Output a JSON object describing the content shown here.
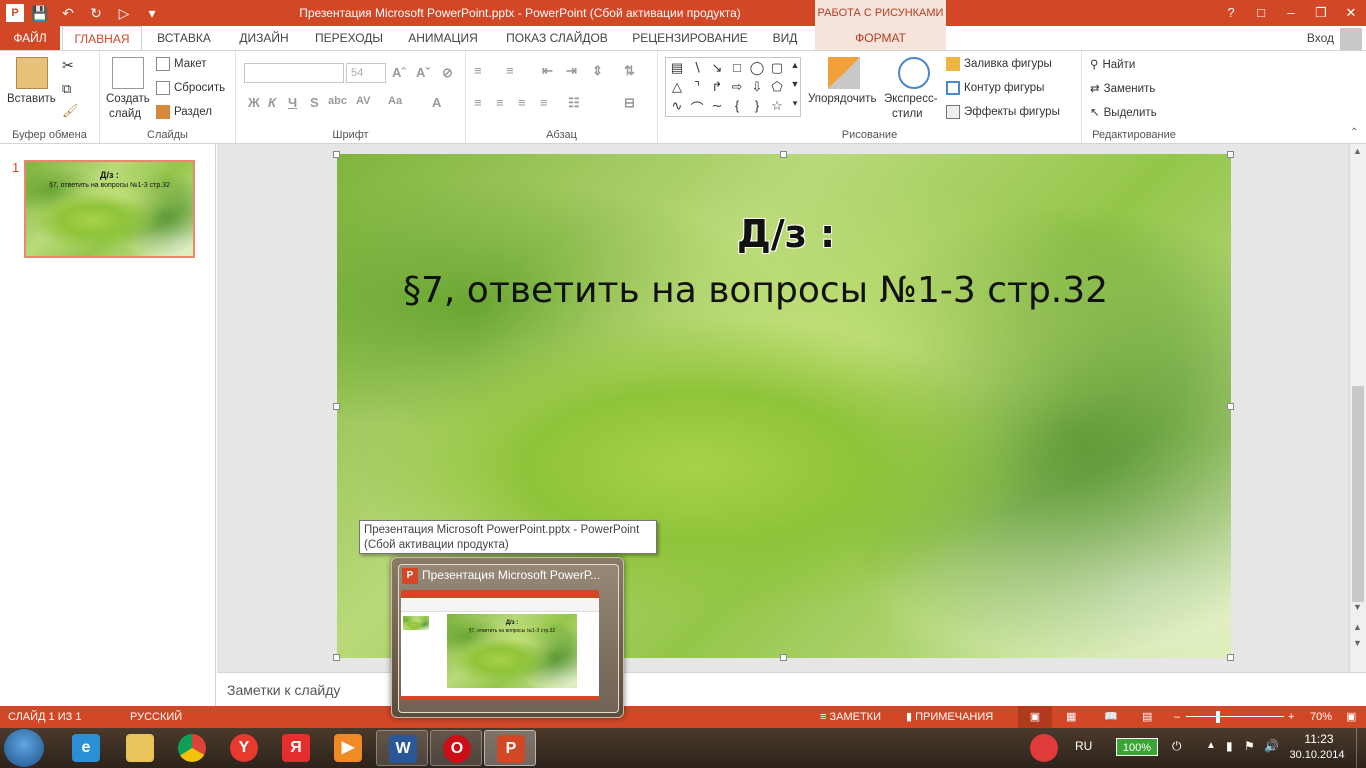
{
  "window": {
    "title": "Презентация Microsoft PowerPoint.pptx - PowerPoint (Сбой активации продукта)",
    "context_header": "РАБОТА С РИСУНКАМИ"
  },
  "tabs": [
    "ФАЙЛ",
    "ГЛАВНАЯ",
    "ВСТАВКА",
    "ДИЗАЙН",
    "ПЕРЕХОДЫ",
    "АНИМАЦИЯ",
    "ПОКАЗ СЛАЙДОВ",
    "РЕЦЕНЗИРОВАНИЕ",
    "ВИД",
    "ФОРМАТ"
  ],
  "signin": "Вход",
  "ribbon": {
    "clipboard": {
      "paste": "Вставить",
      "label": "Буфер обмена"
    },
    "slides": {
      "new_slide_1": "Создать",
      "new_slide_2": "слайд",
      "layout": "Макет",
      "reset": "Сбросить",
      "section": "Раздел",
      "label": "Слайды"
    },
    "font": {
      "size": "54",
      "bold": "Ж",
      "italic": "К",
      "underline": "Ч",
      "strike": "S",
      "label": "Шрифт"
    },
    "paragraph": {
      "label": "Абзац"
    },
    "drawing": {
      "arrange": "Упорядочить",
      "quick_styles_1": "Экспресс-",
      "quick_styles_2": "стили",
      "fill": "Заливка фигуры",
      "outline": "Контур фигуры",
      "effects": "Эффекты фигуры",
      "label": "Рисование"
    },
    "editing": {
      "find": "Найти",
      "replace": "Заменить",
      "select": "Выделить",
      "label": "Редактирование"
    }
  },
  "thumbnail": {
    "number": "1",
    "title": "Д/з :",
    "body": "§7, ответить на вопросы №1-3 стр.32"
  },
  "slide": {
    "title": "Д/з :",
    "body": "§7, ответить на вопросы №1-3 стр.32"
  },
  "notes": {
    "placeholder": "Заметки к слайду"
  },
  "statusbar": {
    "slide_info": "СЛАЙД 1 ИЗ 1",
    "language": "РУССКИЙ",
    "notes": "ЗАМЕТКИ",
    "comments": "ПРИМЕЧАНИЯ",
    "zoom": "70%"
  },
  "tooltip": {
    "line1": "Презентация Microsoft PowerPoint.pptx - PowerPoint",
    "line2": "(Сбой активации продукта)"
  },
  "preview": {
    "title": "Презентация Microsoft PowerP..."
  },
  "taskbar": {
    "lang": "RU",
    "battery": "100%",
    "time": "11:23",
    "date": "30.10.2014"
  },
  "colors": {
    "accent": "#d24726",
    "context": "#f6e3dc"
  }
}
